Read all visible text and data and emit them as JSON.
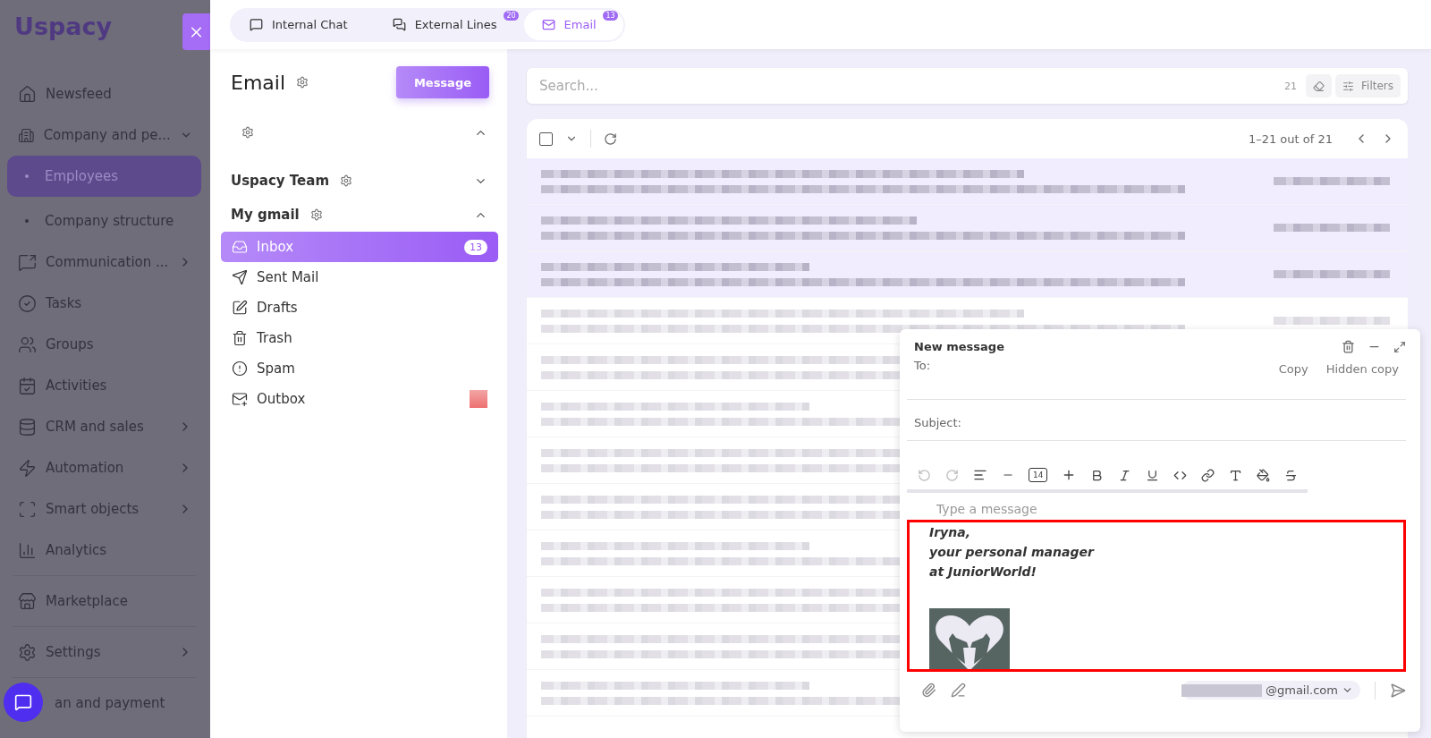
{
  "logo": "Uspacy",
  "nav": [
    {
      "label": "Newsfeed",
      "kind": "link",
      "selected": false
    },
    {
      "label": "Company and pe...",
      "kind": "opengroup",
      "selected": false
    },
    {
      "label": "Employees",
      "kind": "subitem",
      "selected": true
    },
    {
      "label": "Company structure",
      "kind": "subitem",
      "selected": false
    },
    {
      "label": "Communication ...",
      "kind": "group",
      "selected": false
    },
    {
      "label": "Tasks",
      "kind": "link",
      "selected": false
    },
    {
      "label": "Groups",
      "kind": "link",
      "selected": false
    },
    {
      "label": "Activities",
      "kind": "link",
      "selected": false
    },
    {
      "label": "CRM and sales",
      "kind": "group",
      "selected": false
    },
    {
      "label": "Automation",
      "kind": "group",
      "selected": false
    },
    {
      "label": "Smart objects",
      "kind": "group",
      "selected": false
    },
    {
      "label": "Analytics",
      "kind": "link",
      "selected": false,
      "divider": true
    },
    {
      "label": "Marketplace",
      "kind": "link",
      "selected": false,
      "divider": true
    },
    {
      "label": "Settings",
      "kind": "group",
      "selected": false,
      "divider": true
    },
    {
      "label": "an and payment",
      "kind": "link",
      "selected": false
    }
  ],
  "tabs": [
    {
      "label": "Internal Chat",
      "selected": false
    },
    {
      "label": "External Lines",
      "badge": "20",
      "selected": false
    },
    {
      "label": "Email",
      "badge": "13",
      "selected": true
    }
  ],
  "email_panel": {
    "title": "Email",
    "button": "Message",
    "accounts": [
      {
        "expanded": true
      },
      {
        "name": "Uspacy Team",
        "expanded": false
      },
      {
        "name": "My gmail",
        "expanded": true,
        "folders": [
          {
            "label": "Inbox",
            "badge": "13",
            "selected": true
          },
          {
            "label": "Sent Mail",
            "selected": false
          },
          {
            "label": "Drafts",
            "selected": false
          },
          {
            "label": "Trash",
            "selected": false
          },
          {
            "label": "Spam",
            "selected": false
          },
          {
            "label": "Outbox",
            "selected": false,
            "blurred_mark": true
          }
        ]
      }
    ]
  },
  "search": {
    "placeholder": "Search...",
    "count": "21",
    "filters": "Filters"
  },
  "list": {
    "select_all": {
      "checked": false
    },
    "range": "1–21 out of 21",
    "rows": [
      {
        "unread": true
      },
      {
        "unread": true
      },
      {
        "unread": true
      },
      {
        "unread": false
      },
      {
        "unread": false
      },
      {
        "unread": false
      },
      {
        "unread": false
      },
      {
        "unread": false
      },
      {
        "unread": false
      },
      {
        "unread": false
      },
      {
        "unread": false
      },
      {
        "unread": false
      }
    ]
  },
  "compose": {
    "title": "New message",
    "to_label": "To:",
    "copy": "Copy",
    "hidden_copy": "Hidden copy",
    "subject_label": "Subject:",
    "font_size": "14",
    "placeholder": "Type a message",
    "signature": {
      "highlighted": true,
      "lines": [
        "Iryna,",
        "your personal manager",
        "at JuniorWorld!"
      ]
    },
    "sender": "@gmail.com"
  }
}
